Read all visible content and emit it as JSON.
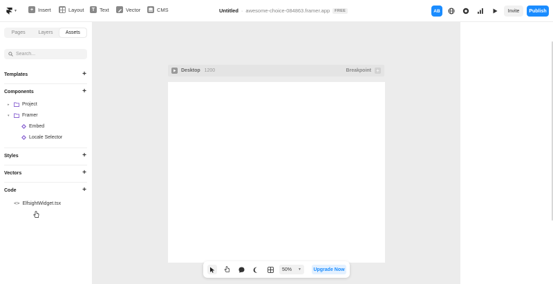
{
  "topbar": {
    "tools": [
      {
        "label": "Insert",
        "icon": "plus-box-icon"
      },
      {
        "label": "Layout",
        "icon": "layout-grid-icon"
      },
      {
        "label": "Text",
        "icon": "text-T-icon"
      },
      {
        "label": "Vector",
        "icon": "pen-icon"
      },
      {
        "label": "CMS",
        "icon": "database-icon"
      }
    ],
    "project_title": "Untitled",
    "separator": "·",
    "project_url": "awesome-choice-084863.framer.app",
    "plan_badge": "FREE",
    "avatar_initials": "AB",
    "invite_label": "Invite",
    "publish_label": "Publish"
  },
  "sidebar": {
    "tabs": [
      "Pages",
      "Layers",
      "Assets"
    ],
    "active_tab": "Assets",
    "search_placeholder": "Search...",
    "sections": {
      "templates": "Templates",
      "components": "Components",
      "styles": "Styles",
      "vectors": "Vectors",
      "code": "Code"
    },
    "components_tree": {
      "project": "Project",
      "framer": "Framer",
      "embed": "Embed",
      "locale_selector": "Locale Selector"
    },
    "code_files": [
      "ElfsightWidget.tsx"
    ]
  },
  "canvas": {
    "frame_name": "Desktop",
    "frame_width": "1200",
    "breakpoint_label": "Breakpoint"
  },
  "bottom_toolbar": {
    "zoom": "50%",
    "upgrade_label": "Upgrade Now"
  },
  "colors": {
    "accent": "#1a8cff",
    "canvas_bg": "#ececec",
    "component_purple": "#8a63d2"
  }
}
